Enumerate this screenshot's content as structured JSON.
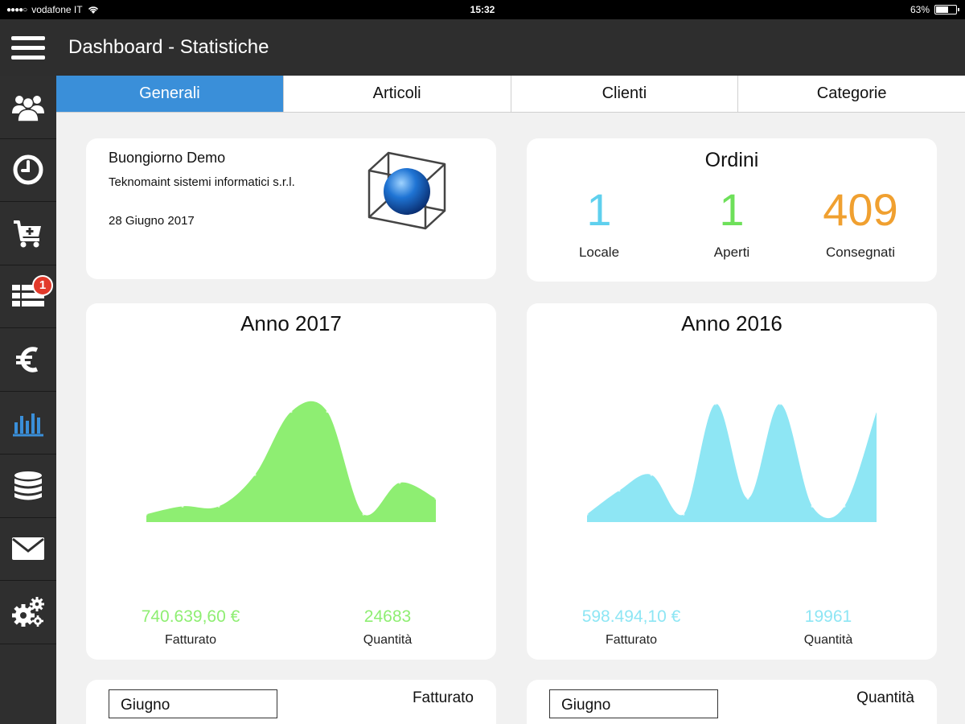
{
  "status_bar": {
    "carrier": "vodafone IT",
    "time": "15:32",
    "battery": "63%",
    "battery_level": 0.63
  },
  "header": {
    "title": "Dashboard - Statistiche"
  },
  "sidebar": {
    "items": [
      {
        "icon": "users-icon"
      },
      {
        "icon": "clock-icon"
      },
      {
        "icon": "cart-add-icon"
      },
      {
        "icon": "list-icon",
        "badge": "1"
      },
      {
        "icon": "euro-icon"
      },
      {
        "icon": "bar-chart-icon",
        "active": true
      },
      {
        "icon": "database-icon"
      },
      {
        "icon": "mail-icon"
      },
      {
        "icon": "gears-icon"
      }
    ],
    "active_color": "#3a8fd9"
  },
  "tabs": [
    {
      "label": "Generali",
      "active": true
    },
    {
      "label": "Articoli"
    },
    {
      "label": "Clienti"
    },
    {
      "label": "Categorie"
    }
  ],
  "greeting": {
    "hello": "Buongiorno Demo",
    "company": "Teknomaint sistemi informatici s.r.l.",
    "date": "28 Giugno 2017"
  },
  "orders": {
    "title": "Ordini",
    "items": [
      {
        "value": "1",
        "label": "Locale",
        "color": "#5fd0ee"
      },
      {
        "value": "1",
        "label": "Aperti",
        "color": "#6ee05a"
      },
      {
        "value": "409",
        "label": "Consegnati",
        "color": "#f0a030"
      }
    ]
  },
  "years": {
    "y2017": {
      "title": "Anno 2017",
      "revenue": "740.639,60 €",
      "revenue_label": "Fatturato",
      "quantity": "24683",
      "quantity_label": "Quantità",
      "color": "#8eee72"
    },
    "y2016": {
      "title": "Anno 2016",
      "revenue": "598.494,10 €",
      "revenue_label": "Fatturato",
      "quantity": "19961",
      "quantity_label": "Quantità",
      "color": "#8ee6f4"
    }
  },
  "chart_data": [
    {
      "type": "area",
      "values": [
        1,
        2,
        2,
        6,
        14,
        14,
        1,
        5,
        3
      ],
      "ylim": [
        0,
        15
      ]
    },
    {
      "type": "area",
      "values": [
        1,
        4,
        6,
        1,
        15,
        3,
        15,
        2,
        2,
        14
      ],
      "ylim": [
        0,
        15
      ]
    }
  ],
  "bottom": {
    "b1": {
      "selected": "Giugno",
      "label": "Fatturato"
    },
    "b2": {
      "selected": "Giugno",
      "label": "Quantità"
    }
  }
}
